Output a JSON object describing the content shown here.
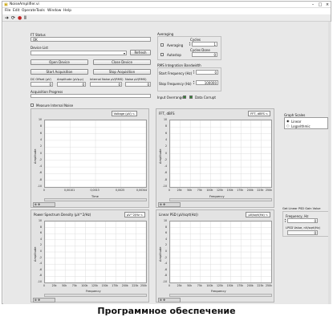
{
  "window": {
    "title": "NoiseAmplifier.vi"
  },
  "menu": [
    "File",
    "Edit",
    "Operate",
    "Tools",
    "Window",
    "Help"
  ],
  "left": {
    "ft_status_label": "FT Status",
    "ft_status_value": "OK",
    "device_list_label": "Device List",
    "refresh_label": "Refresh",
    "open_device_label": "Open Device",
    "close_device_label": "Close Device",
    "start_acq_label": "Start Acquisition",
    "stop_acq_label": "Stop Acquisition",
    "dc_offset_label": "DC Offset (μV)",
    "dc_offset_value": "0",
    "amplitude_label": "Amplitude (μVp-p)",
    "amplitude_value": "0",
    "internal_noise_label": "Internal Noise μV(RMS)",
    "internal_noise_value": "0",
    "noise_label": "Noise μV(RMS)",
    "noise_value": "0",
    "acq_progress_label": "Acquisition Progress",
    "measure_internal_label": "Measure Internal Noise"
  },
  "right": {
    "averaging_group": "Averaging",
    "averaging_label": "Averaging",
    "autostop_label": "Autostop",
    "cycles_label": "Cycles",
    "cycles_value": "1",
    "cycles_done_label": "Cycles Done",
    "cycles_done_value": "0",
    "rms_group": "RMS Integration Bandwidth",
    "start_freq_label": "Start Frequency (Hz)",
    "start_freq_value": "0",
    "stop_freq_label": "Stop Frequency (Hz)",
    "stop_freq_value": "100000",
    "input_overrange_label": "Input Overrange",
    "data_corrupt_label": "Data Corrupt",
    "graph_scales_label": "Graph Scales",
    "scale_options": [
      "Linear",
      "Logarithmic"
    ],
    "get_linear_label": "Get Linear PSD Gain Value",
    "frequency_label": "Frequency, Hz",
    "frequency_value": "0",
    "lpsd_label": "LPSD Value, nV/sqrt(Hz)",
    "lpsd_value": "0"
  },
  "graphs": {
    "voltage": {
      "legend": "Voltage (μV)",
      "ylabel": "Amplitude",
      "xlabel": "Time",
      "yticks": [
        "10",
        "8",
        "6",
        "4",
        "2",
        "0",
        "-2",
        "-4",
        "-6",
        "-8",
        "-10"
      ],
      "xticks": [
        "0",
        "0,00101",
        "0,0013",
        "0,0025",
        "0,00344"
      ]
    },
    "fft": {
      "title": "FFT, dBFS",
      "legend": "FFT, dBFS",
      "ylabel": "Amplitude",
      "xlabel": "Frequency",
      "yticks": [
        "10",
        "8",
        "6",
        "4",
        "2",
        "0",
        "-2",
        "-4",
        "-6",
        "-8",
        "-10"
      ],
      "xticks": [
        "0",
        "25k",
        "50k",
        "75k",
        "100k",
        "125k",
        "150k",
        "175k",
        "200k",
        "225k",
        "250k"
      ]
    },
    "psd": {
      "title": "Power Spectrum Density (μV^2/Hz)",
      "legend": "μV^2/Hz",
      "ylabel": "Amplitude",
      "xlabel": "Frequency",
      "yticks": [
        "10",
        "8",
        "6",
        "4",
        "2",
        "0",
        "-2",
        "-4",
        "-6",
        "-8",
        "-10"
      ],
      "xticks": [
        "0",
        "25k",
        "50k",
        "75k",
        "100k",
        "125k",
        "150k",
        "175k",
        "200k",
        "225k",
        "250k"
      ]
    },
    "lpsd": {
      "title": "Linear PSD (μV/sqrt(Hz))",
      "legend": "μV/sqrt(Hz)",
      "ylabel": "Amplitude",
      "xlabel": "Frequency",
      "yticks": [
        "10",
        "8",
        "6",
        "4",
        "2",
        "0",
        "-2",
        "-4",
        "-6",
        "-8",
        "-10"
      ],
      "xticks": [
        "0",
        "25k",
        "50k",
        "75k",
        "100k",
        "125k",
        "150k",
        "175k",
        "200k",
        "225k",
        "250k"
      ]
    }
  },
  "caption": "Программное обеспечение"
}
